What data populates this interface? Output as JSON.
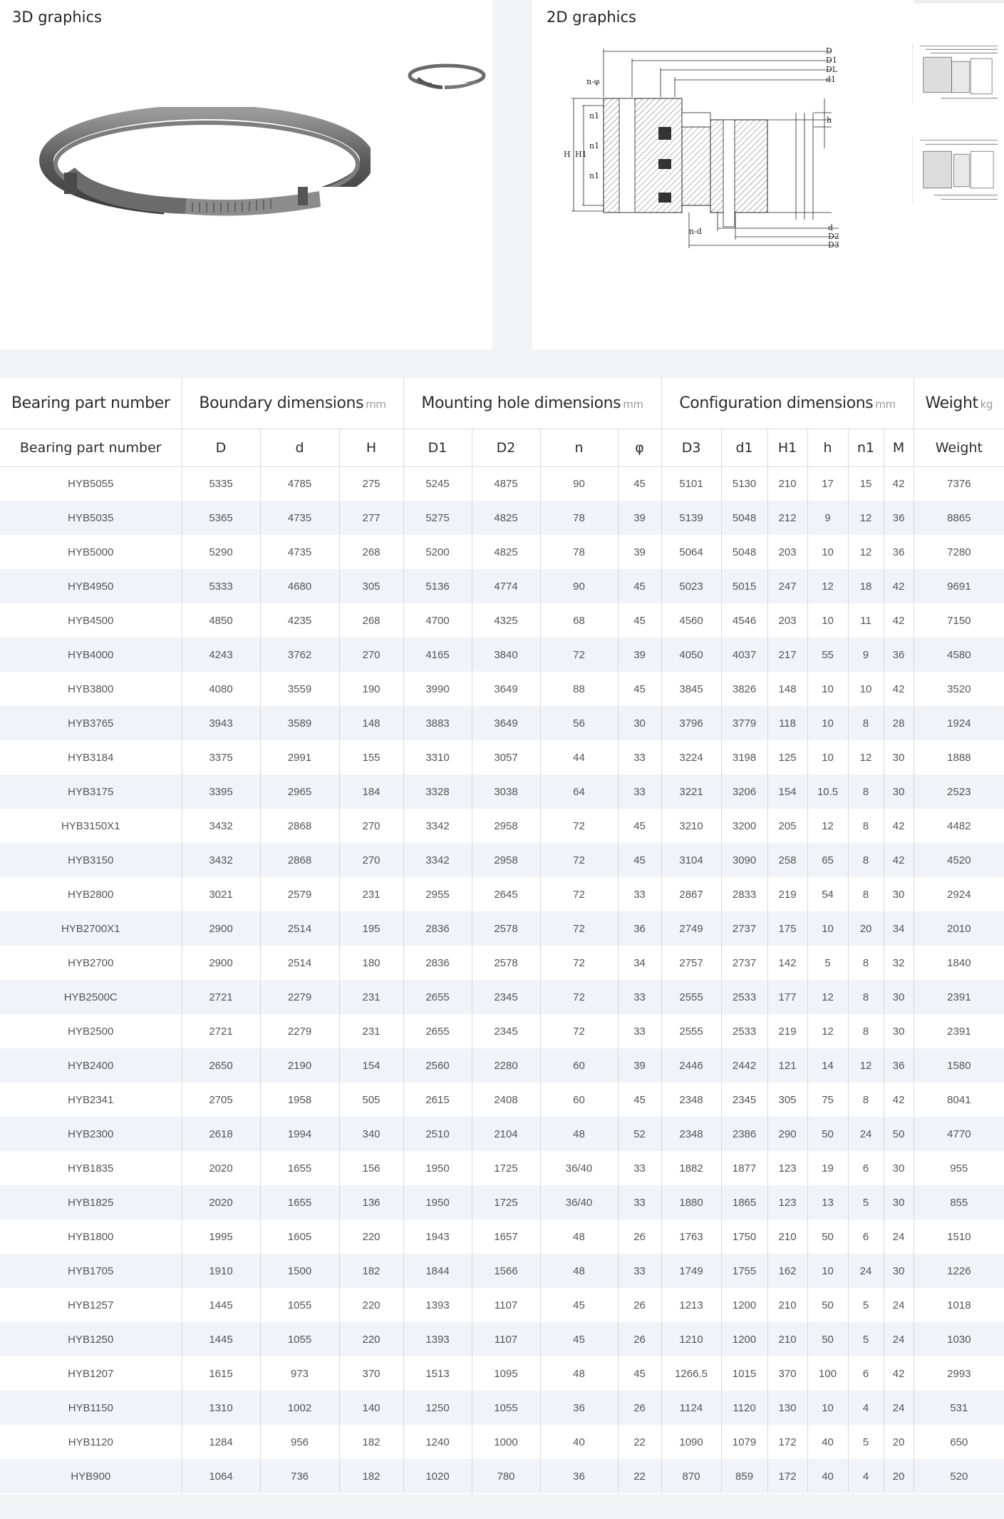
{
  "graphics": {
    "title_3d": "3D graphics",
    "title_2d": "2D graphics",
    "icons": [
      "slewing-ring-3d-image",
      "slewing-ring-thumbnail",
      "cross-section-drawing",
      "drawing-thumbnail-1",
      "drawing-thumbnail-2"
    ],
    "drawing_labels": {
      "D": "D",
      "D1": "D1",
      "DL": "DL",
      "d1": "d1",
      "n_phi": "n-φ",
      "n1_a": "n1",
      "n1_b": "n1",
      "n1_c": "n1",
      "H": "H",
      "H1": "H1",
      "h": "h",
      "n_d": "n-d",
      "d": "d",
      "D2": "D2",
      "D3": "D3"
    }
  },
  "table": {
    "groups": [
      {
        "label": "Bearing part number",
        "unit": ""
      },
      {
        "label": "Boundary dimensions",
        "unit": "mm"
      },
      {
        "label": "Mounting hole dimensions",
        "unit": "mm"
      },
      {
        "label": "Configuration dimensions",
        "unit": "mm"
      },
      {
        "label": "Weight",
        "unit": "kg"
      }
    ],
    "columns": [
      "Bearing part number",
      "D",
      "d",
      "H",
      "D1",
      "D2",
      "n",
      "φ",
      "D3",
      "d1",
      "H1",
      "h",
      "n1",
      "M",
      "Weight"
    ],
    "rows": [
      [
        "HYB5055",
        "5335",
        "4785",
        "275",
        "5245",
        "4875",
        "90",
        "45",
        "5101",
        "5130",
        "210",
        "17",
        "15",
        "42",
        "7376"
      ],
      [
        "HYB5035",
        "5365",
        "4735",
        "277",
        "5275",
        "4825",
        "78",
        "39",
        "5139",
        "5048",
        "212",
        "9",
        "12",
        "36",
        "8865"
      ],
      [
        "HYB5000",
        "5290",
        "4735",
        "268",
        "5200",
        "4825",
        "78",
        "39",
        "5064",
        "5048",
        "203",
        "10",
        "12",
        "36",
        "7280"
      ],
      [
        "HYB4950",
        "5333",
        "4680",
        "305",
        "5136",
        "4774",
        "90",
        "45",
        "5023",
        "5015",
        "247",
        "12",
        "18",
        "42",
        "9691"
      ],
      [
        "HYB4500",
        "4850",
        "4235",
        "268",
        "4700",
        "4325",
        "68",
        "45",
        "4560",
        "4546",
        "203",
        "10",
        "11",
        "42",
        "7150"
      ],
      [
        "HYB4000",
        "4243",
        "3762",
        "270",
        "4165",
        "3840",
        "72",
        "39",
        "4050",
        "4037",
        "217",
        "55",
        "9",
        "36",
        "4580"
      ],
      [
        "HYB3800",
        "4080",
        "3559",
        "190",
        "3990",
        "3649",
        "88",
        "45",
        "3845",
        "3826",
        "148",
        "10",
        "10",
        "42",
        "3520"
      ],
      [
        "HYB3765",
        "3943",
        "3589",
        "148",
        "3883",
        "3649",
        "56",
        "30",
        "3796",
        "3779",
        "118",
        "10",
        "8",
        "28",
        "1924"
      ],
      [
        "HYB3184",
        "3375",
        "2991",
        "155",
        "3310",
        "3057",
        "44",
        "33",
        "3224",
        "3198",
        "125",
        "10",
        "12",
        "30",
        "1888"
      ],
      [
        "HYB3175",
        "3395",
        "2965",
        "184",
        "3328",
        "3038",
        "64",
        "33",
        "3221",
        "3206",
        "154",
        "10.5",
        "8",
        "30",
        "2523"
      ],
      [
        "HYB3150X1",
        "3432",
        "2868",
        "270",
        "3342",
        "2958",
        "72",
        "45",
        "3210",
        "3200",
        "205",
        "12",
        "8",
        "42",
        "4482"
      ],
      [
        "HYB3150",
        "3432",
        "2868",
        "270",
        "3342",
        "2958",
        "72",
        "45",
        "3104",
        "3090",
        "258",
        "65",
        "8",
        "42",
        "4520"
      ],
      [
        "HYB2800",
        "3021",
        "2579",
        "231",
        "2955",
        "2645",
        "72",
        "33",
        "2867",
        "2833",
        "219",
        "54",
        "8",
        "30",
        "2924"
      ],
      [
        "HYB2700X1",
        "2900",
        "2514",
        "195",
        "2836",
        "2578",
        "72",
        "36",
        "2749",
        "2737",
        "175",
        "10",
        "20",
        "34",
        "2010"
      ],
      [
        "HYB2700",
        "2900",
        "2514",
        "180",
        "2836",
        "2578",
        "72",
        "34",
        "2757",
        "2737",
        "142",
        "5",
        "8",
        "32",
        "1840"
      ],
      [
        "HYB2500C",
        "2721",
        "2279",
        "231",
        "2655",
        "2345",
        "72",
        "33",
        "2555",
        "2533",
        "177",
        "12",
        "8",
        "30",
        "2391"
      ],
      [
        "HYB2500",
        "2721",
        "2279",
        "231",
        "2655",
        "2345",
        "72",
        "33",
        "2555",
        "2533",
        "219",
        "12",
        "8",
        "30",
        "2391"
      ],
      [
        "HYB2400",
        "2650",
        "2190",
        "154",
        "2560",
        "2280",
        "60",
        "39",
        "2446",
        "2442",
        "121",
        "14",
        "12",
        "36",
        "1580"
      ],
      [
        "HYB2341",
        "2705",
        "1958",
        "505",
        "2615",
        "2408",
        "60",
        "45",
        "2348",
        "2345",
        "305",
        "75",
        "8",
        "42",
        "8041"
      ],
      [
        "HYB2300",
        "2618",
        "1994",
        "340",
        "2510",
        "2104",
        "48",
        "52",
        "2348",
        "2386",
        "290",
        "50",
        "24",
        "50",
        "4770"
      ],
      [
        "HYB1835",
        "2020",
        "1655",
        "156",
        "1950",
        "1725",
        "36/40",
        "33",
        "1882",
        "1877",
        "123",
        "19",
        "6",
        "30",
        "955"
      ],
      [
        "HYB1825",
        "2020",
        "1655",
        "136",
        "1950",
        "1725",
        "36/40",
        "33",
        "1880",
        "1865",
        "123",
        "13",
        "5",
        "30",
        "855"
      ],
      [
        "HYB1800",
        "1995",
        "1605",
        "220",
        "1943",
        "1657",
        "48",
        "26",
        "1763",
        "1750",
        "210",
        "50",
        "6",
        "24",
        "1510"
      ],
      [
        "HYB1705",
        "1910",
        "1500",
        "182",
        "1844",
        "1566",
        "48",
        "33",
        "1749",
        "1755",
        "162",
        "10",
        "24",
        "30",
        "1226"
      ],
      [
        "HYB1257",
        "1445",
        "1055",
        "220",
        "1393",
        "1107",
        "45",
        "26",
        "1213",
        "1200",
        "210",
        "50",
        "5",
        "24",
        "1018"
      ],
      [
        "HYB1250",
        "1445",
        "1055",
        "220",
        "1393",
        "1107",
        "45",
        "26",
        "1210",
        "1200",
        "210",
        "50",
        "5",
        "24",
        "1030"
      ],
      [
        "HYB1207",
        "1615",
        "973",
        "370",
        "1513",
        "1095",
        "48",
        "45",
        "1266.5",
        "1015",
        "370",
        "100",
        "6",
        "42",
        "2993"
      ],
      [
        "HYB1150",
        "1310",
        "1002",
        "140",
        "1250",
        "1055",
        "36",
        "26",
        "1124",
        "1120",
        "130",
        "10",
        "4",
        "24",
        "531"
      ],
      [
        "HYB1120",
        "1284",
        "956",
        "182",
        "1240",
        "1000",
        "40",
        "22",
        "1090",
        "1079",
        "172",
        "40",
        "5",
        "20",
        "650"
      ],
      [
        "HYB900",
        "1064",
        "736",
        "182",
        "1020",
        "780",
        "36",
        "22",
        "870",
        "859",
        "172",
        "40",
        "4",
        "20",
        "520"
      ]
    ]
  }
}
